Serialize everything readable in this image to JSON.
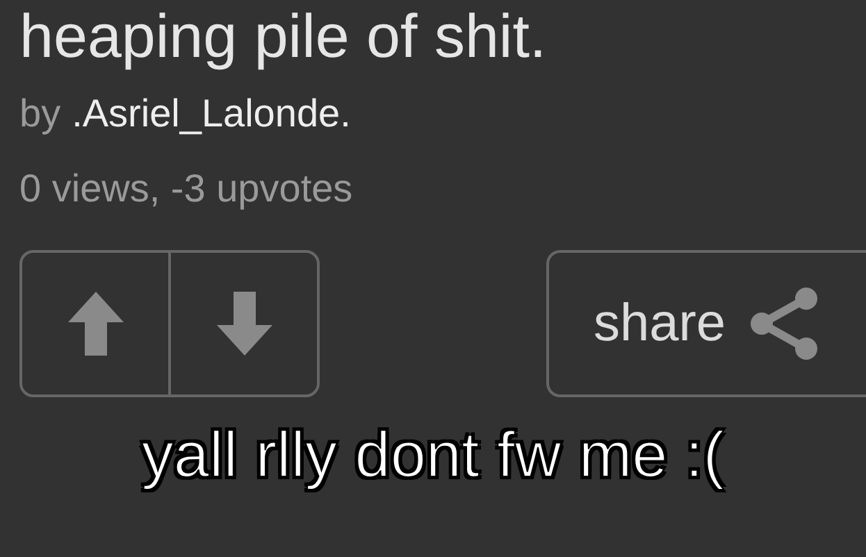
{
  "title": "heaping pile of shit.",
  "byline": {
    "prefix": "by",
    "author": ".Asriel_Lalonde."
  },
  "stats": "0 views, -3 upvotes",
  "share": {
    "label": "share"
  },
  "caption": "yall rlly dont fw me :("
}
